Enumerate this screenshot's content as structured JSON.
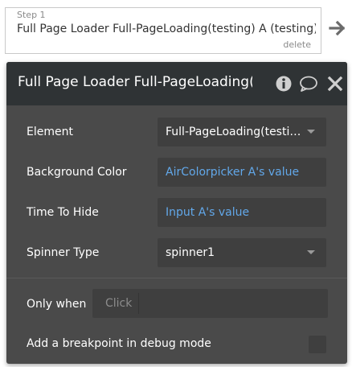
{
  "step": {
    "number_label": "Step 1",
    "title": "Full Page Loader Full-PageLoading(testing) A (testing)",
    "delete_label": "delete",
    "next_icon": "arrow-right-icon"
  },
  "panel": {
    "title": "Full Page Loader Full-PageLoading(testing) A",
    "icons": [
      "info-icon",
      "comment-icon",
      "close-icon"
    ],
    "fields": {
      "element": {
        "label": "Element",
        "value": "Full-PageLoading(testing) A"
      },
      "background_color": {
        "label": "Background Color",
        "value": "AirColorpicker A's value"
      },
      "time_to_hide": {
        "label": "Time To Hide",
        "value": "Input A's value"
      },
      "spinner_type": {
        "label": "Spinner Type",
        "value": "spinner1"
      }
    },
    "only_when": {
      "label": "Only when",
      "placeholder": "Click"
    },
    "breakpoint": {
      "label": "Add a breakpoint in debug mode",
      "checked": false
    }
  },
  "colors": {
    "panel_bg": "#4a4a4a",
    "header_bg": "#2f3335",
    "field_bg": "#3f3f3f",
    "dynamic_value": "#62a8ea"
  }
}
